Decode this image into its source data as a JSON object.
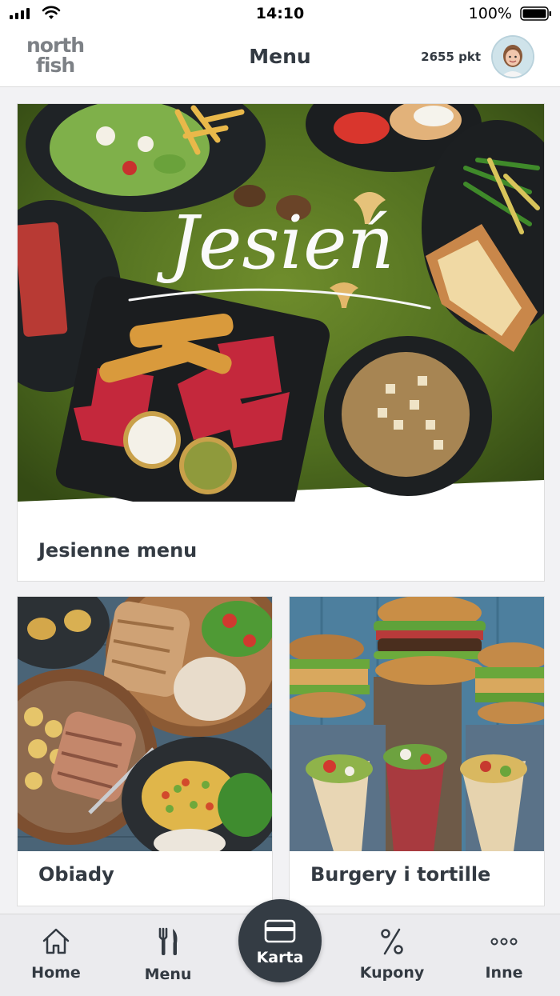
{
  "status_bar": {
    "time": "14:10",
    "battery": "100%"
  },
  "header": {
    "logo_line1": "north",
    "logo_line2": "fish",
    "title": "Menu",
    "points": "2655 pkt"
  },
  "cards": {
    "featured": {
      "label": "Jesienne menu",
      "banner_text": "Jesień"
    },
    "left": {
      "label": "Obiady"
    },
    "right": {
      "label": "Burgery i tortille"
    }
  },
  "tabbar": {
    "home": "Home",
    "menu": "Menu",
    "karta": "Karta",
    "kupony": "Kupony",
    "inne": "Inne"
  },
  "colors": {
    "text_dark": "#333a42",
    "card_button": "#343c44",
    "tabbar_bg": "#ebebee",
    "moss_green": "#4d6b1e"
  },
  "icons": [
    "signal-icon",
    "wifi-icon",
    "battery-icon",
    "home-icon",
    "fork-knife-icon",
    "card-icon",
    "percent-icon",
    "more-dots-icon"
  ]
}
